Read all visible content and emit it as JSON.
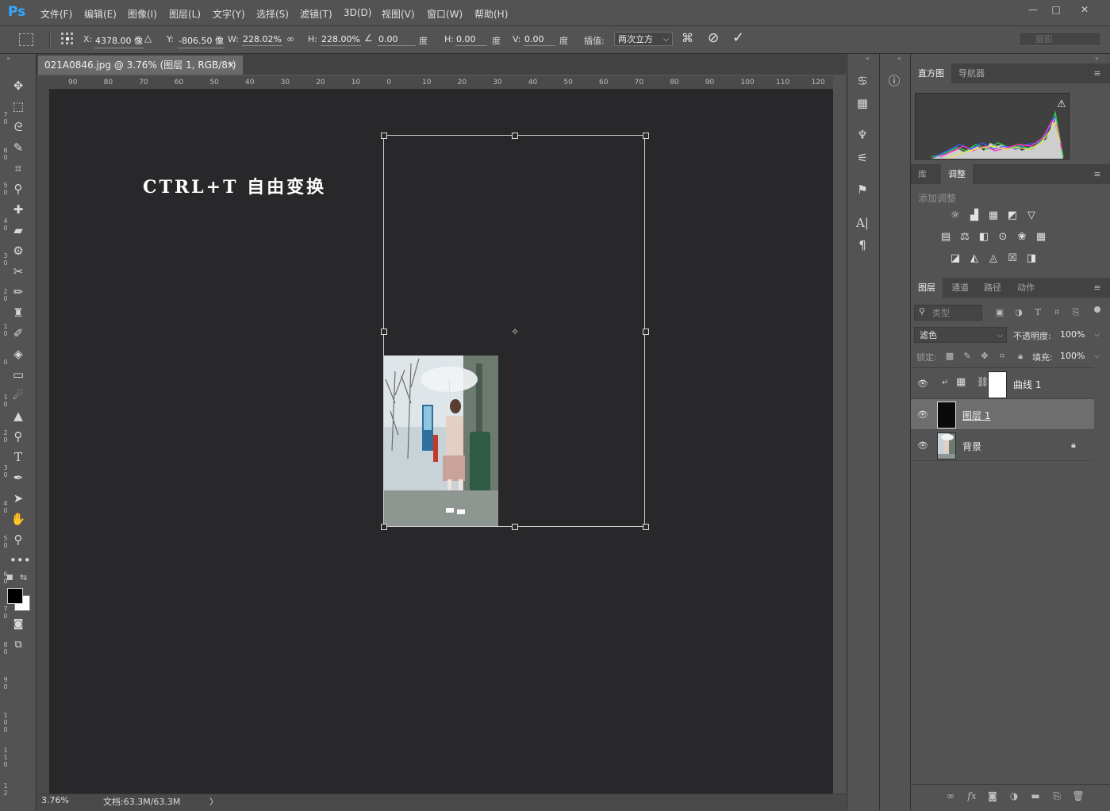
{
  "app": {
    "logo": "Ps"
  },
  "menus": [
    "文件(F)",
    "编辑(E)",
    "图像(I)",
    "图层(L)",
    "文字(Y)",
    "选择(S)",
    "滤镜(T)",
    "3D(D)",
    "视图(V)",
    "窗口(W)",
    "帮助(H)"
  ],
  "window_controls": {
    "minimize": "—",
    "maximize": "□",
    "close": "✕"
  },
  "options": {
    "x_label": "X:",
    "x_value": "4378.00 像",
    "y_label": "Y:",
    "y_value": "-806.50 像",
    "w_label": "W:",
    "w_value": "228.02%",
    "h_label": "H:",
    "h_value": "228.00%",
    "angle_value": "0.00",
    "angle_unit": "度",
    "hskew_label": "H:",
    "hskew_value": "0.00",
    "hskew_unit": "度",
    "vskew_label": "V:",
    "vskew_value": "0.00",
    "vskew_unit": "度",
    "interp_label": "插值:",
    "interp_value": "两次立方",
    "search_placeholder": "摄影"
  },
  "document": {
    "tab_title": "021A0846.jpg @ 3.76% (图层 1, RGB/8*) *",
    "tab_close": "×",
    "caption": "CTRL+T  自由变换",
    "ruler_top": [
      "90",
      "80",
      "70",
      "60",
      "50",
      "40",
      "30",
      "20",
      "10",
      "0",
      "10",
      "20",
      "30",
      "40",
      "50",
      "60",
      "70",
      "80",
      "90",
      "100",
      "110",
      "120"
    ],
    "ruler_left": [
      "7\n0",
      "6\n0",
      "5\n0",
      "4\n0",
      "3\n0",
      "2\n0",
      "1\n0",
      "0",
      "1\n0",
      "2\n0",
      "3\n0",
      "4\n0",
      "5\n0",
      "6\n0",
      "7\n0",
      "8\n0",
      "9\n0",
      "1\n0\n0",
      "1\n1\n0",
      "1\n2"
    ]
  },
  "status": {
    "zoom": "3.76%",
    "doc_info": "文档:63.3M/63.3M",
    "arrow": "〉"
  },
  "panels": {
    "top_tabs": [
      "直方图",
      "导航器"
    ],
    "adj_tabs": [
      "库",
      "调整"
    ],
    "adj_title": "添加调整",
    "layer_tabs": [
      "图层",
      "通道",
      "路径",
      "动作"
    ],
    "filter_kind": "类型",
    "blend_mode": "滤色",
    "opacity_label": "不透明度:",
    "opacity_value": "100%",
    "lock_label": "锁定:",
    "fill_label": "填充:",
    "fill_value": "100%",
    "layers": [
      {
        "name": "曲线 1"
      },
      {
        "name": "图层 1"
      },
      {
        "name": "背景"
      }
    ]
  },
  "colors": {
    "canvas": "#282729",
    "panel": "#535353",
    "ps_blue": "#31a8ff"
  }
}
